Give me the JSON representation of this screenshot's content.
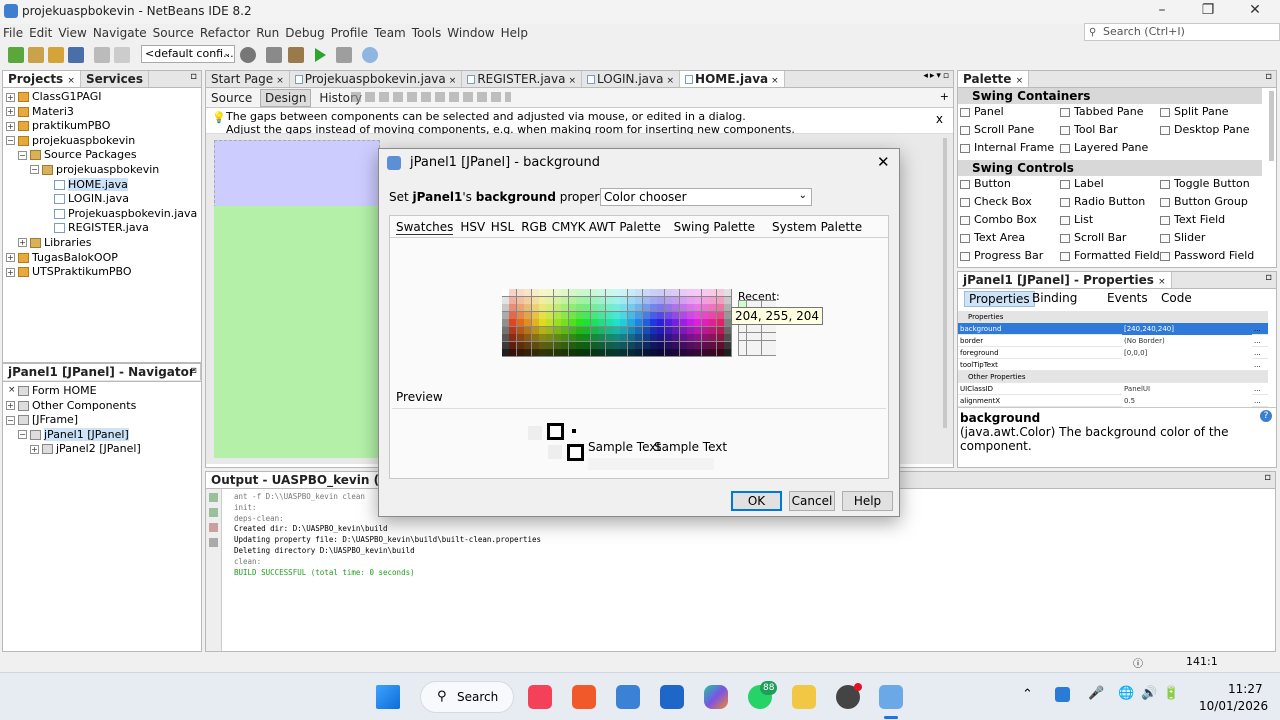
{
  "window": {
    "title": "projekuaspbokevin - NetBeans IDE 8.2"
  },
  "menu": [
    "File",
    "Edit",
    "View",
    "Navigate",
    "Source",
    "Refactor",
    "Run",
    "Debug",
    "Profile",
    "Team",
    "Tools",
    "Window",
    "Help"
  ],
  "search": {
    "placeholder": "Search (Ctrl+I)"
  },
  "toolbar": {
    "config": "<default confi..."
  },
  "projects": {
    "tabs": [
      "Projects",
      "Services"
    ],
    "tree": [
      {
        "label": "ClassG1PAGI",
        "level": 0,
        "exp": "+",
        "icon": "proj"
      },
      {
        "label": "Materi3",
        "level": 0,
        "exp": "+",
        "icon": "proj"
      },
      {
        "label": "praktikumPBO",
        "level": 0,
        "exp": "+",
        "icon": "proj"
      },
      {
        "label": "projekuaspbokevin",
        "level": 0,
        "exp": "-",
        "icon": "proj"
      },
      {
        "label": "Source Packages",
        "level": 1,
        "exp": "-",
        "icon": "pkg"
      },
      {
        "label": "projekuaspbokevin",
        "level": 2,
        "exp": "-",
        "icon": "pkg"
      },
      {
        "label": "HOME.java",
        "level": 3,
        "exp": "",
        "icon": "java",
        "selected": true
      },
      {
        "label": "LOGIN.java",
        "level": 3,
        "exp": "",
        "icon": "java"
      },
      {
        "label": "Projekuaspbokevin.java",
        "level": 3,
        "exp": "",
        "icon": "java"
      },
      {
        "label": "REGISTER.java",
        "level": 3,
        "exp": "",
        "icon": "java"
      },
      {
        "label": "Libraries",
        "level": 1,
        "exp": "+",
        "icon": "pkg"
      },
      {
        "label": "TugasBalokOOP",
        "level": 0,
        "exp": "+",
        "icon": "proj"
      },
      {
        "label": "UTSPraktikumPBO",
        "level": 0,
        "exp": "+",
        "icon": "proj"
      }
    ]
  },
  "navigator": {
    "title": "jPanel1 [JPanel] - Navigator",
    "tree": [
      {
        "label": "Form HOME",
        "level": 0,
        "exp": "",
        "icon": "frm"
      },
      {
        "label": "Other Components",
        "level": 0,
        "exp": "+",
        "icon": "frm"
      },
      {
        "label": "[JFrame]",
        "level": 0,
        "exp": "-",
        "icon": "frm"
      },
      {
        "label": "jPanel1 [JPanel]",
        "level": 1,
        "exp": "-",
        "icon": "frm",
        "selected": true
      },
      {
        "label": "jPanel2 [JPanel]",
        "level": 2,
        "exp": "+",
        "icon": "frm"
      }
    ]
  },
  "editor": {
    "tabs": [
      "Start Page",
      "Projekuaspbokevin.java",
      "REGISTER.java",
      "LOGIN.java",
      "HOME.java"
    ],
    "subtabs": [
      "Source",
      "Design",
      "History"
    ],
    "hint_line1": "The gaps between components can be selected and adjusted via mouse, or edited in a dialog.",
    "hint_line2": "Adjust the gaps instead of moving components, e.g. when making room for inserting new components.",
    "hint_close": "x"
  },
  "output": {
    "title": "Output - UASPBO_kevin (clean)",
    "lines": [
      {
        "text": "ant -f D:\\\\UASPBO_kevin clean",
        "color": "#777777"
      },
      {
        "text": "init:",
        "color": "#777777"
      },
      {
        "text": "deps-clean:",
        "color": "#777777"
      },
      {
        "text": "Created dir: D:\\UASPBO_kevin\\build",
        "color": "#000000"
      },
      {
        "text": "Updating property file: D:\\UASPBO_kevin\\build\\built-clean.properties",
        "color": "#000000"
      },
      {
        "text": "Deleting directory D:\\UASPBO_kevin\\build",
        "color": "#000000"
      },
      {
        "text": "clean:",
        "color": "#777777"
      },
      {
        "text": "BUILD SUCCESSFUL (total time: 0 seconds)",
        "color": "#1f9d1f"
      }
    ]
  },
  "palette": {
    "title": "Palette",
    "sections": [
      {
        "name": "Swing Containers",
        "items": [
          "Panel",
          "Tabbed Pane",
          "Split Pane",
          "Scroll Pane",
          "Tool Bar",
          "Desktop Pane",
          "Internal Frame",
          "Layered Pane"
        ]
      },
      {
        "name": "Swing Controls",
        "items": [
          "Button",
          "Label",
          "Toggle Button",
          "Check Box",
          "Radio Button",
          "Button Group",
          "Combo Box",
          "List",
          "Text Field",
          "Text Area",
          "Scroll Bar",
          "Slider",
          "Progress Bar",
          "Formatted Field",
          "Password Field"
        ]
      }
    ]
  },
  "properties": {
    "title": "jPanel1 [JPanel] - Properties",
    "tabs": [
      "Properties",
      "Binding",
      "Events",
      "Code"
    ],
    "section1": "Properties",
    "rows1": [
      {
        "name": "background",
        "value": "[240,240,240]",
        "selected": true
      },
      {
        "name": "border",
        "value": "(No Border)"
      },
      {
        "name": "foreground",
        "value": "[0,0,0]"
      },
      {
        "name": "toolTipText",
        "value": ""
      }
    ],
    "section2": "Other Properties",
    "rows2": [
      {
        "name": "UIClassID",
        "value": "PanelUI"
      },
      {
        "name": "alignmentX",
        "value": "0.5"
      }
    ],
    "help_title": "background",
    "help_text": "(java.awt.Color) The background color of the component."
  },
  "dialog": {
    "title": "jPanel1 [JPanel] - background",
    "set_prefix": "Set ",
    "set_bold": "jPanel1",
    "set_mid": "'s ",
    "set_bold2": "background",
    "set_suffix": " property using:",
    "mode": "Color chooser",
    "tabs": [
      "Swatches",
      "HSV",
      "HSL",
      "RGB",
      "CMYK",
      "AWT Palette",
      "Swing Palette",
      "System Palette"
    ],
    "recent_label": "Recent:",
    "tooltip": "204, 255, 204",
    "preview_label": "Preview",
    "sample1": "Sample Text",
    "sample2": "Sample Text",
    "ok": "OK",
    "cancel": "Cancel",
    "help": "Help"
  },
  "status": {
    "position": "141:1"
  },
  "taskbar": {
    "search": "Search",
    "badge": "88",
    "time": "11:27",
    "date": "10/01/2026"
  }
}
